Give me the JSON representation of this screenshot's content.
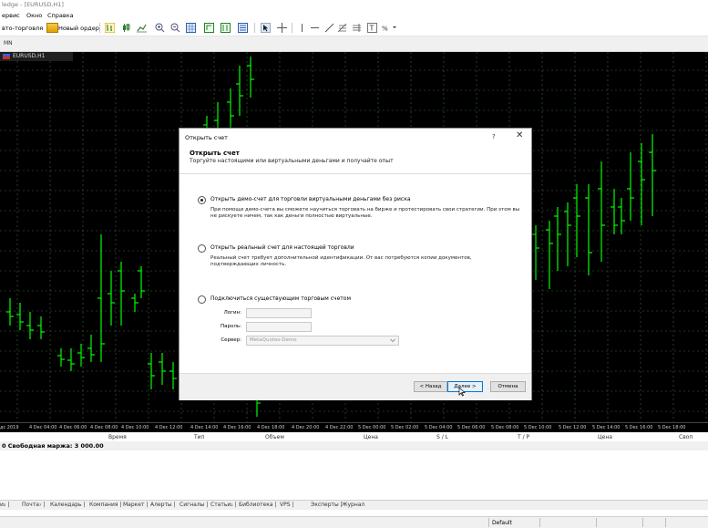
{
  "window": {
    "title": "ledge - [EURUSD,H1]"
  },
  "menu": {
    "items": [
      "ервис",
      "Окно",
      "Справка"
    ]
  },
  "toolbar": {
    "autotrading_label": "вто-торговля",
    "new_order_label": "Новый ордер",
    "icons": [
      "bar-chart-icon",
      "candles-icon",
      "line-chart-icon",
      "zoom-in-icon",
      "zoom-out-icon",
      "grid-icon",
      "autoscroll-icon",
      "chart-shift-icon",
      "period-icon",
      "cursor-icon",
      "crosshair-icon",
      "vertical-line-icon",
      "horizontal-line-icon",
      "trendline-icon",
      "fibonacci-icon",
      "channel-icon",
      "text-icon",
      "percent-icon"
    ]
  },
  "timeframes": {
    "current": "MN"
  },
  "chart": {
    "tab_label": "EURUSD,H1",
    "colors": {
      "background": "#000000",
      "candle": "#00ff00",
      "grid": "#3a6a3a"
    },
    "time_labels": [
      "дс 2019",
      "4 Dec 04:00",
      "4 Dec 06:00",
      "4 Dec 08:00",
      "4 Dec 10:00",
      "4 Dec 12:00",
      "4 Dec 14:00",
      "4 Dec 16:00",
      "4 Dec 18:00",
      "4 Dec 20:00",
      "4 Dec 22:00",
      "5 Dec 00:00",
      "5 Dec 02:00",
      "5 Dec 04:00",
      "5 Dec 06:00",
      "5 Dec 08:00",
      "5 Dec 10:00",
      "5 Dec 12:00",
      "5 Dec 14:00",
      "5 Dec 16:00",
      "5 Dec 18:00"
    ]
  },
  "terminal": {
    "columns": [
      "Время",
      "Тип",
      "Объем",
      "Цена",
      "S / L",
      "T / P",
      "Цена",
      "Своп"
    ],
    "margin_text": "0 Свободная маржа: 3 000.00",
    "tabs": [
      "и₂",
      "Почта₇",
      "Календарь",
      "Компания",
      "Маркет",
      "Алерты",
      "Сигналы",
      "Статьи₂",
      "Библиотека",
      "VPS",
      "Эксперты",
      "Журнал"
    ]
  },
  "status": {
    "profile": "Default"
  },
  "dialog": {
    "title": "Открыть счет",
    "help": "?",
    "close": "✕",
    "header_title": "Открыть счет",
    "header_subtitle": "Торгуйте настоящими или виртуальными деньгами и получайте опыт",
    "options": [
      {
        "label": "Открыть демо-счет для торговли виртуальными деньгами без риска",
        "description": "При помощи демо-счета вы сможете научиться торговать на бирже и протестировать свои стратегии. При этом вы не рискуете ничем, так как деньги полностью виртуальные.",
        "selected": true
      },
      {
        "label": "Открыть реальный счет для настоящей торговли",
        "description": "Реальный счет требует дополнительной идентификации. От вас потребуются копии документов, подтверждающих личность.",
        "selected": false
      },
      {
        "label": "Подключиться существующим торговым счетом",
        "description": "",
        "selected": false
      }
    ],
    "login_label": "Логин:",
    "login_value": "",
    "password_label": "Пароль:",
    "password_value": "",
    "server_label": "Сервер:",
    "server_value": "MetaQuotes-Demo",
    "back_button": "< Назад",
    "next_button": "Далее >",
    "cancel_button": "Отмена"
  }
}
